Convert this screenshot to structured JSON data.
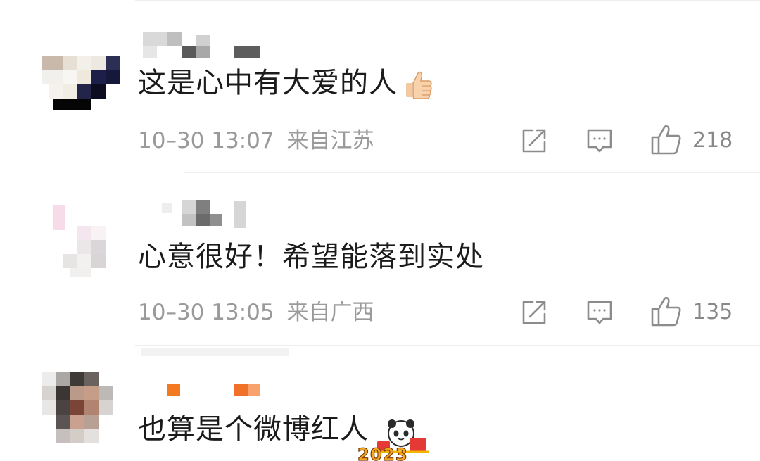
{
  "comments": [
    {
      "text": "这是心中有大爱的人",
      "emoji": "thumbs-up-emoji",
      "time": "10–30 13:07",
      "location": "来自江苏",
      "likes": "218"
    },
    {
      "text": "心意很好！希望能落到实处",
      "time": "10–30 13:05",
      "location": "来自广西",
      "likes": "135"
    },
    {
      "text": "也算是个微博红人",
      "sticker": "2023-new-year-sticker"
    }
  ],
  "icons": {
    "share": "share-icon",
    "comment": "comment-icon",
    "like": "like-icon"
  },
  "colors": {
    "text": "#1b1b1b",
    "meta": "#9a9a9a",
    "icon": "#8c8c8c",
    "divider": "#eeeeee"
  }
}
